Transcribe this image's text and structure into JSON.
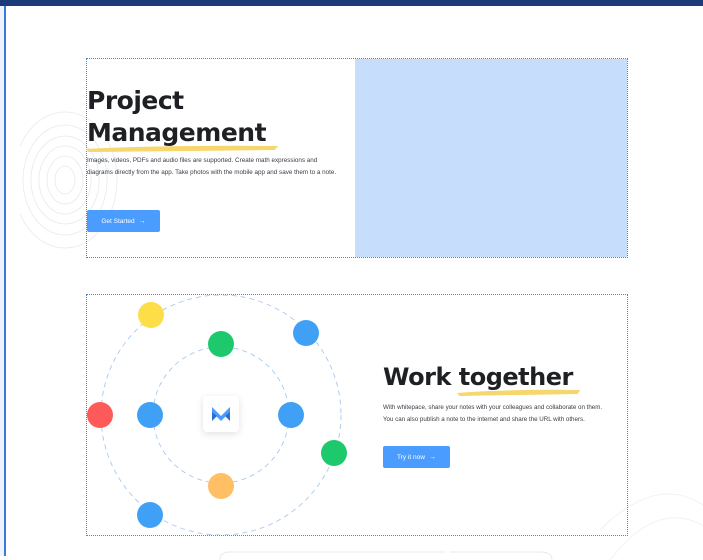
{
  "project_management": {
    "title_line1": "Project",
    "title_line2": "Management",
    "description": "Images, videos, PDFs and audio files are supported. Create math expressions and diagrams directly from the app. Take photos with the mobile app and save them to a note.",
    "button_label": "Get Started",
    "button_arrow": "→"
  },
  "work_together": {
    "title_prefix": "Work ",
    "title_highlight": "together",
    "description_line1": "With whitepace, share your notes with your colleagues and collaborate on them.",
    "description_line2": "You can also publish a note to the internet and share the URL with others.",
    "button_label": "Try it now",
    "button_arrow": "→"
  },
  "colors": {
    "accent_blue": "#4b9cff",
    "image_placeholder": "#c6defb",
    "highlight_yellow": "#f5d76e",
    "dot_yellow": "#fddd48",
    "dot_green": "#1ec96e",
    "dot_red": "#ff5a5a",
    "dot_blue": "#3fa0f5",
    "dot_orange": "#ffbf64"
  },
  "icons": {
    "app_logo": "whitepace-logo-icon"
  }
}
